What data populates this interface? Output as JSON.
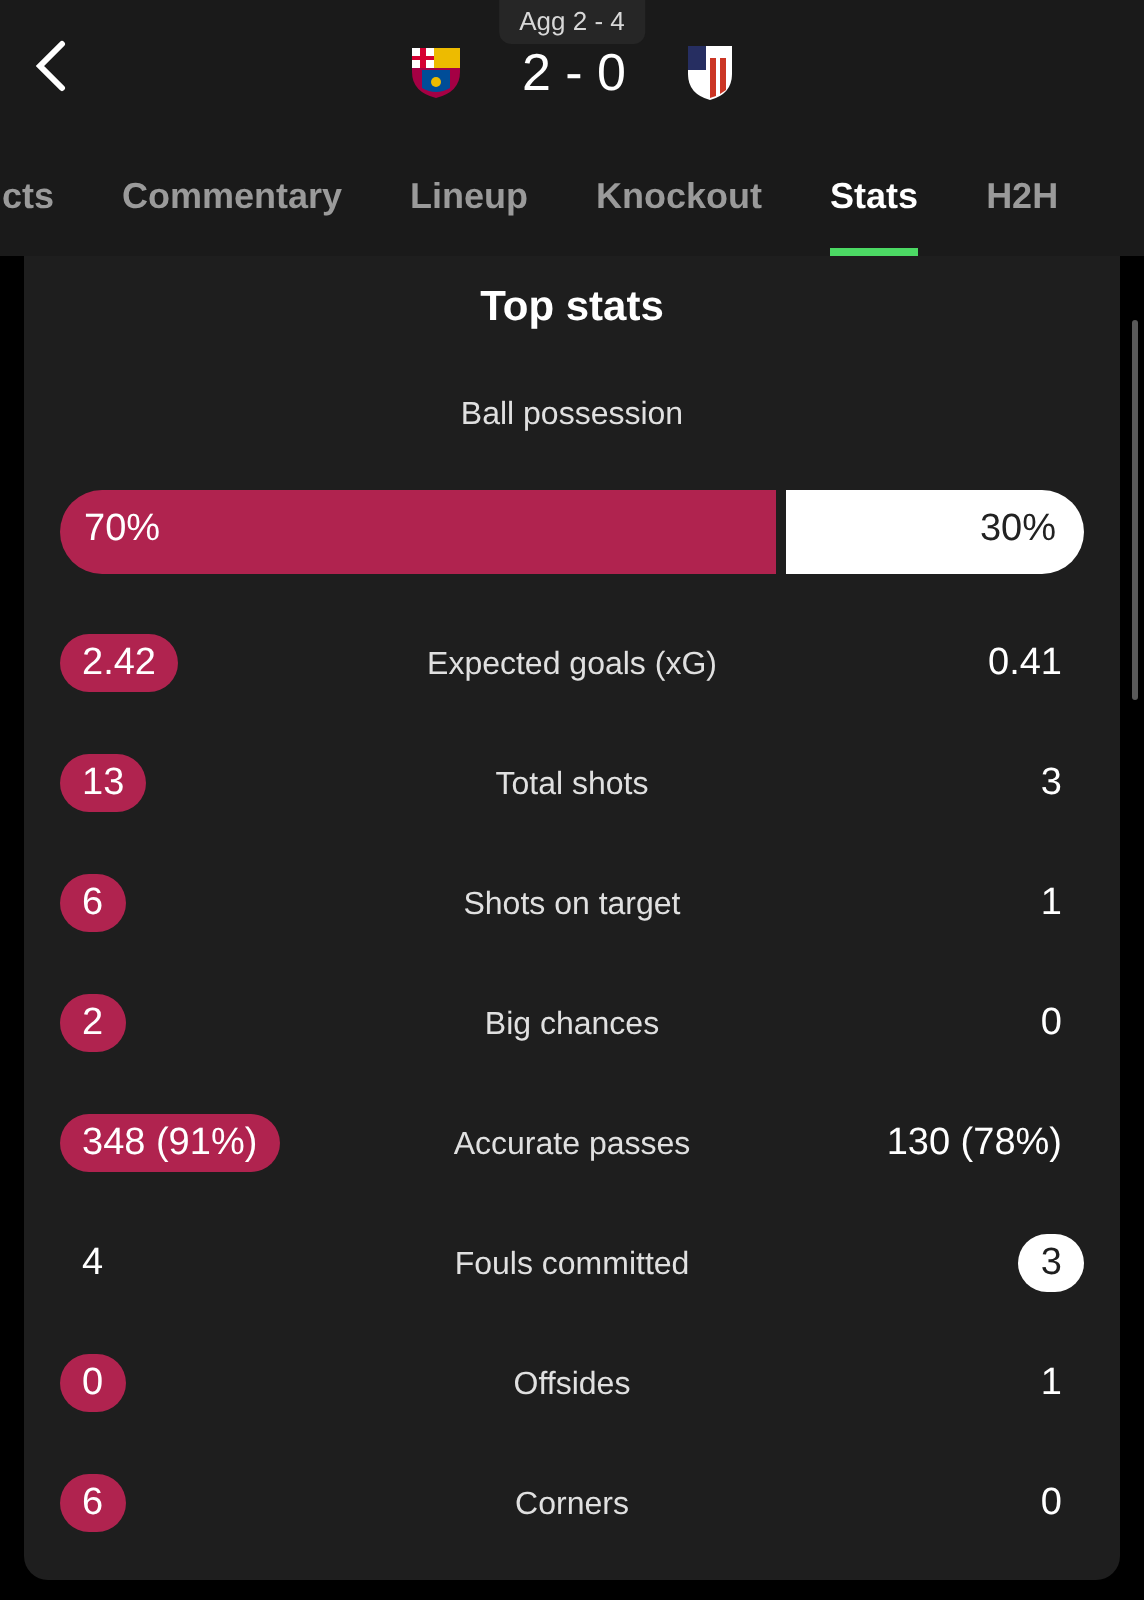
{
  "header": {
    "aggregate": "Agg 2 - 4",
    "score": "2 - 0"
  },
  "tabs": [
    {
      "label": "cts",
      "selected": false
    },
    {
      "label": "Commentary",
      "selected": false
    },
    {
      "label": "Lineup",
      "selected": false
    },
    {
      "label": "Knockout",
      "selected": false
    },
    {
      "label": "Stats",
      "selected": true
    },
    {
      "label": "H2H",
      "selected": false
    }
  ],
  "card": {
    "title": "Top stats",
    "possession": {
      "label": "Ball possession",
      "home": "70%",
      "away": "30%",
      "level": 0.7
    },
    "stats": [
      {
        "label": "Expected goals (xG)",
        "home": "2.42",
        "away": "0.41",
        "home_highlight": true,
        "away_highlight": false
      },
      {
        "label": "Total shots",
        "home": "13",
        "away": "3",
        "home_highlight": true,
        "away_highlight": false
      },
      {
        "label": "Shots on target",
        "home": "6",
        "away": "1",
        "home_highlight": true,
        "away_highlight": false
      },
      {
        "label": "Big chances",
        "home": "2",
        "away": "0",
        "home_highlight": true,
        "away_highlight": false
      },
      {
        "label": "Accurate passes",
        "home": "348 (91%)",
        "away": "130 (78%)",
        "home_highlight": true,
        "away_highlight": false
      },
      {
        "label": "Fouls committed",
        "home": "4",
        "away": "3",
        "home_highlight": false,
        "away_highlight": true
      },
      {
        "label": "Offsides",
        "home": "0",
        "away": "1",
        "home_highlight": true,
        "away_highlight": false
      },
      {
        "label": "Corners",
        "home": "6",
        "away": "0",
        "home_highlight": true,
        "away_highlight": false
      }
    ]
  }
}
